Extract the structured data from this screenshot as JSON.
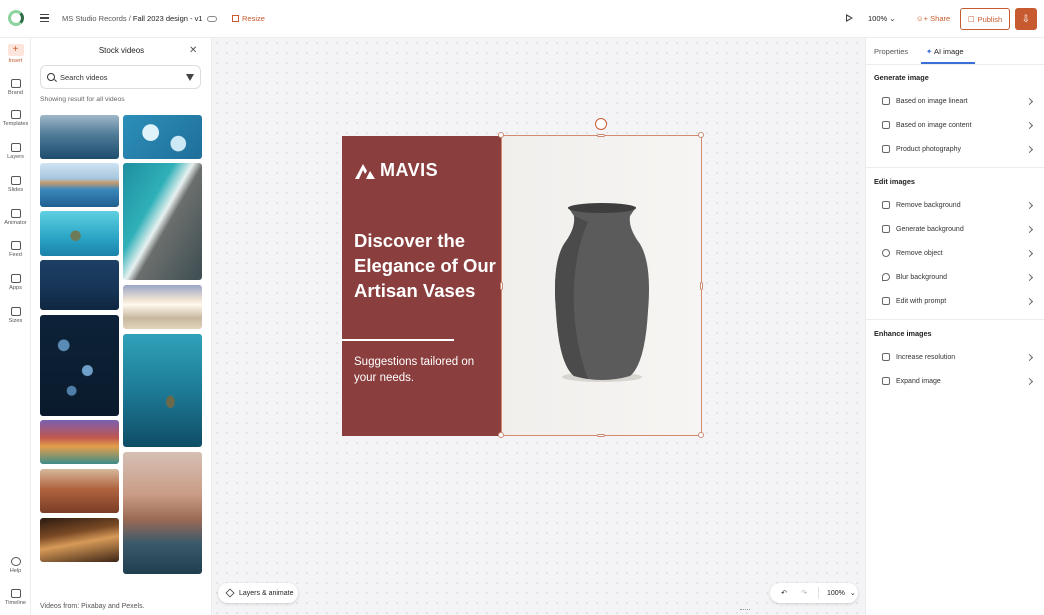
{
  "header": {
    "project": "MS Studio Records",
    "separator": " / ",
    "document": "Fall 2023 design - v1",
    "resize_label": "Resize",
    "zoom": "100%",
    "share_label": "Share",
    "publish_label": "Publish"
  },
  "rail": {
    "items": [
      {
        "label": "Insert",
        "icon": "plus-icon"
      },
      {
        "label": "Brand",
        "icon": "brand-icon"
      },
      {
        "label": "Templates",
        "icon": "templates-icon"
      },
      {
        "label": "Layers",
        "icon": "layers-icon"
      },
      {
        "label": "Slides",
        "icon": "slides-icon"
      },
      {
        "label": "Animator",
        "icon": "animator-icon"
      },
      {
        "label": "Feed",
        "icon": "feed-icon"
      },
      {
        "label": "Apps",
        "icon": "apps-icon"
      },
      {
        "label": "Sizes",
        "icon": "sizes-icon"
      }
    ],
    "help_label": "Help",
    "timeline_label": "Timeline"
  },
  "stock_panel": {
    "title": "Stock videos",
    "search_placeholder": "Search videos",
    "result_note": "Showing result for all videos",
    "footnote": "Videos from: Pixabay and Pexels."
  },
  "design": {
    "brand": "MAVIS",
    "headline": "Discover the Elegance of Our Artisan Vases",
    "subtext": "Suggestions tailored on your needs.",
    "colors": {
      "panel": "#8b3e3e",
      "accent": "#c85a2f"
    }
  },
  "canvas_controls": {
    "layers_label": "Layers & animate",
    "zoom": "100%"
  },
  "right_panel": {
    "tabs": [
      "Properties",
      "AI image"
    ],
    "active_tab": "AI image",
    "sections": [
      {
        "title": "Generate image",
        "items": [
          "Based on image lineart",
          "Based on image content",
          "Product photography"
        ]
      },
      {
        "title": "Edit images",
        "items": [
          "Remove background",
          "Generate background",
          "Remove object",
          "Blur background",
          "Edit with prompt"
        ]
      },
      {
        "title": "Enhance images",
        "items": [
          "Increase resolution",
          "Expand image"
        ]
      }
    ]
  }
}
